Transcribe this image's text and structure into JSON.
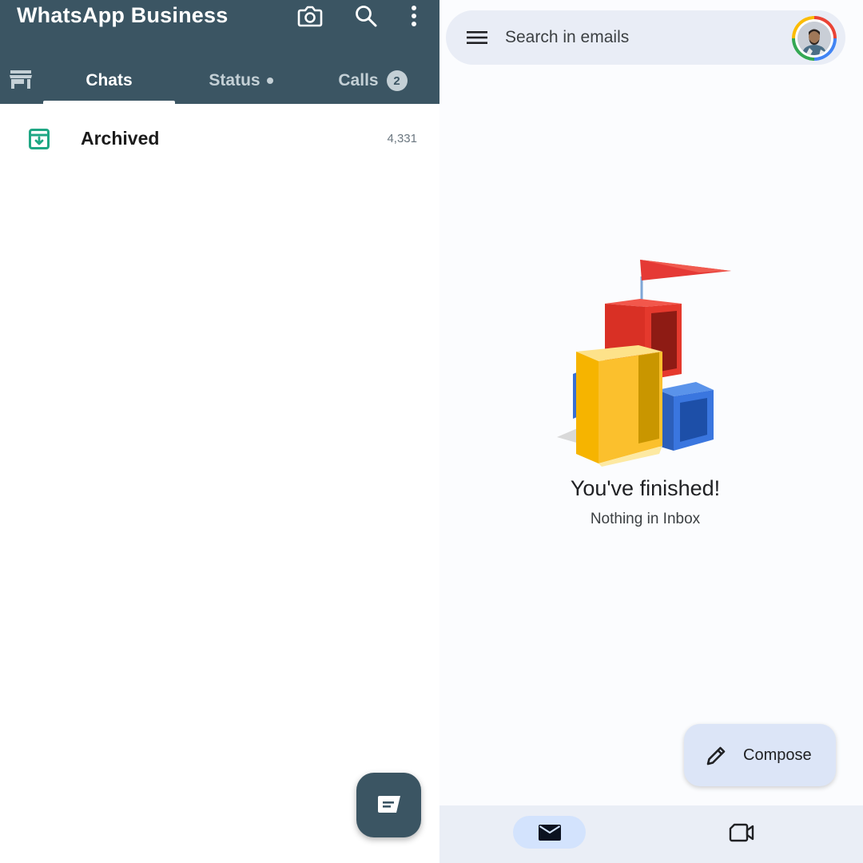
{
  "whatsapp": {
    "title": "WhatsApp Business",
    "header_icons": [
      "camera-icon",
      "search-icon",
      "more-vert-icon",
      "store-icon"
    ],
    "tabs": [
      {
        "label": "Chats",
        "active": true
      },
      {
        "label": "Status",
        "active": false
      },
      {
        "label": "Calls",
        "active": false,
        "badge": "2"
      }
    ],
    "archived": {
      "label": "Archived",
      "count": "4,331",
      "icon": "archive-icon"
    },
    "fab_icon": "new-chat-icon",
    "colors": {
      "header": "#3b5563",
      "archive_icon": "#1fa784"
    }
  },
  "gmail": {
    "search": {
      "placeholder": "Search in emails"
    },
    "empty_state": {
      "title": "You've finished!",
      "subtitle": "Nothing in Inbox"
    },
    "compose": {
      "label": "Compose",
      "icon": "pencil-icon"
    },
    "bottom_nav": [
      {
        "name": "mail-icon",
        "active": true
      },
      {
        "name": "video-camera-icon",
        "active": false
      }
    ],
    "colors": {
      "search_bg": "#e9edf6",
      "compose_bg": "#dce5f7",
      "nav_active": "#d3e3fd"
    }
  }
}
